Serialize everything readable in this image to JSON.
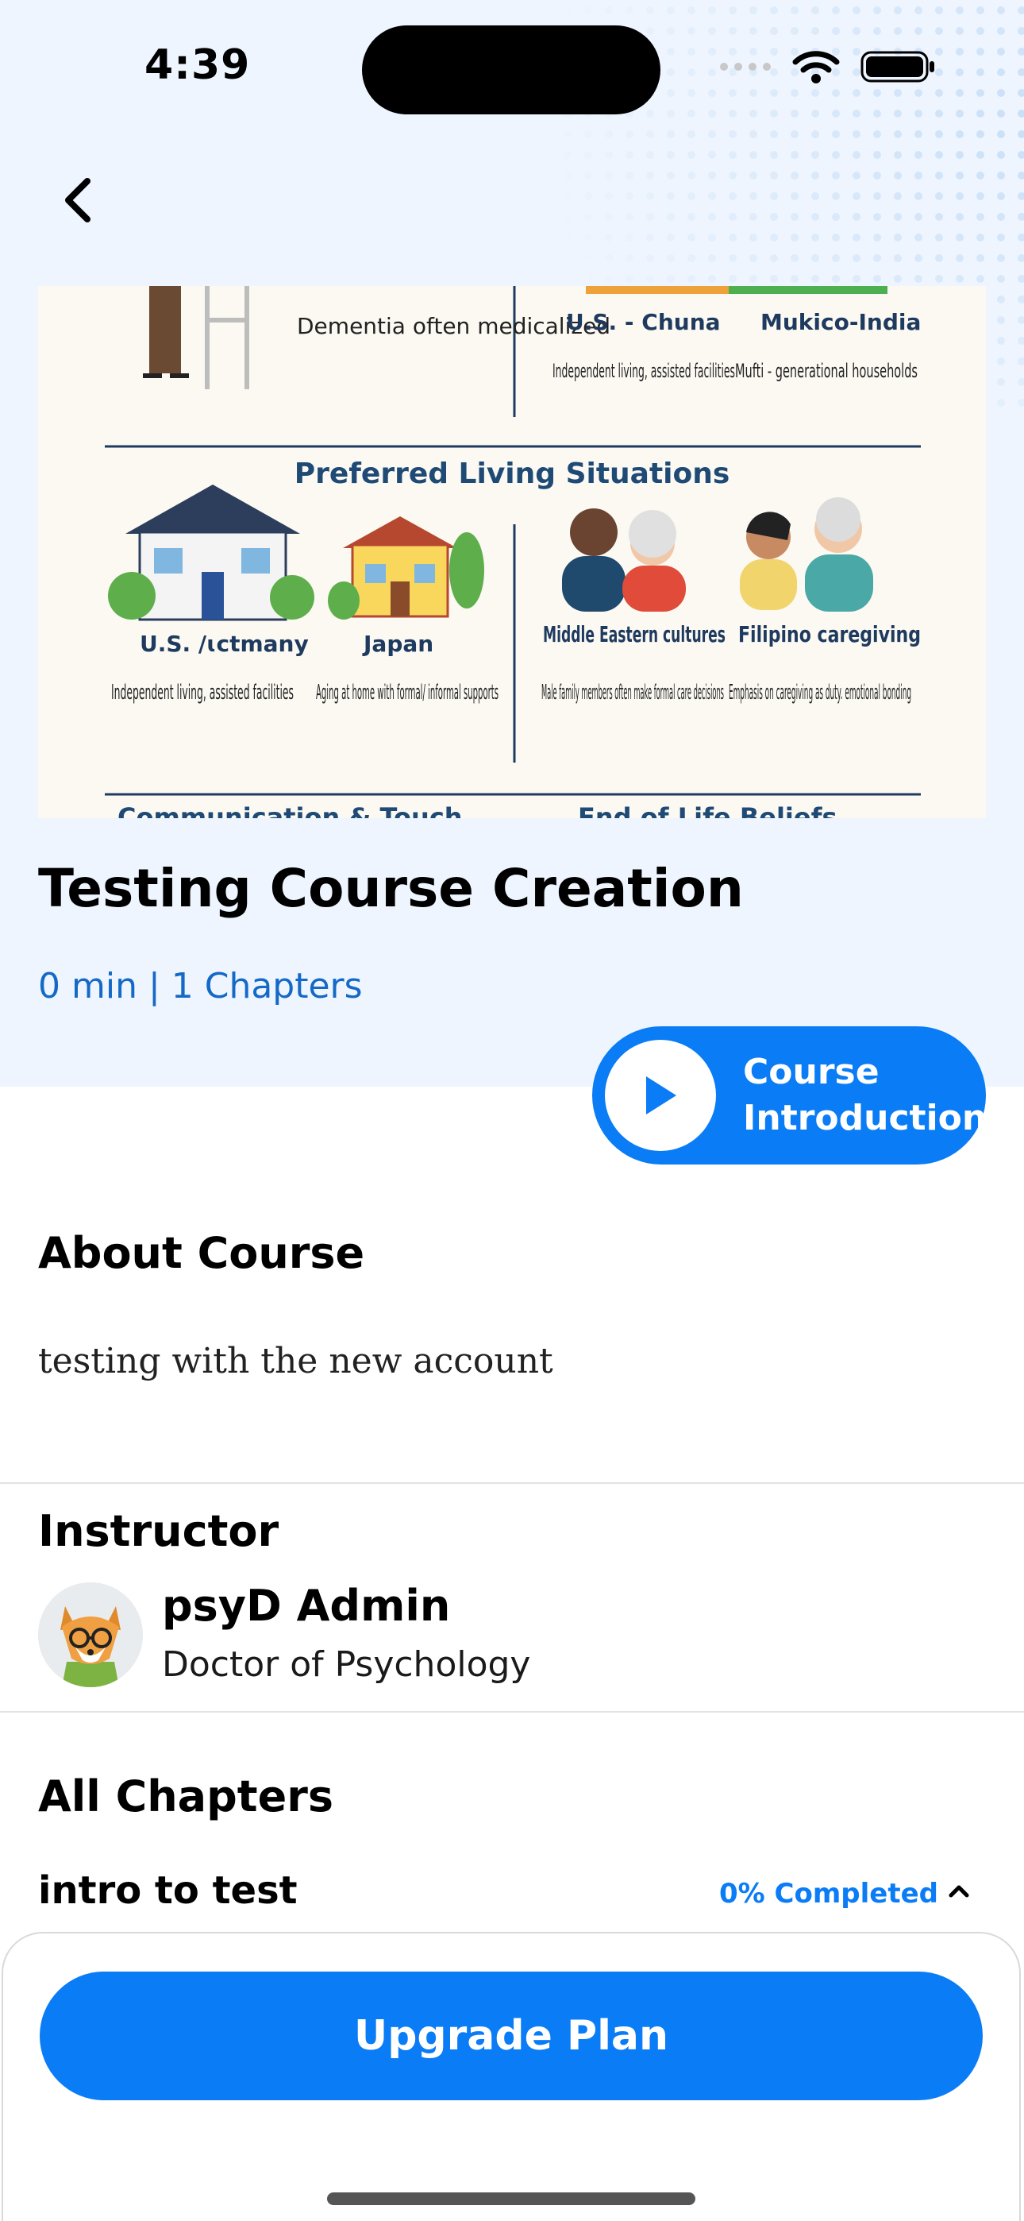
{
  "status_bar": {
    "time": "4:39"
  },
  "course": {
    "title": "Testing Course Creation",
    "meta": "0 min | 1 Chapters",
    "intro_button": "Course Introduction"
  },
  "hero_image": {
    "top_left_note": "Dementia often medicalized",
    "top_col1_title": "U.S. - Chuna",
    "top_col1_text": "Independent living, assisted facilities",
    "top_col2_title": "Mukico-India",
    "top_col2_text": "Mufti - generational households",
    "section_heading": "Preferred Living Situations",
    "cells": [
      {
        "title": "U.S. /ɩctmany",
        "text": "Independent living, assisted facilities"
      },
      {
        "title": "Japan",
        "text": "Aging at home with formal/ informal supports"
      },
      {
        "title": "Middle Eastern cultures",
        "text": "Male family members often make formal care decisions"
      },
      {
        "title": "Filipino caregiving",
        "text": "Emphasis on caregiving as duty. emotional bonding"
      }
    ],
    "bottom_cut_left": "Communication & Touch",
    "bottom_cut_right": "End of Life Beliefs"
  },
  "about": {
    "title": "About Course",
    "text": "testing with the new account"
  },
  "instructor": {
    "title": "Instructor",
    "name": "psyD Admin",
    "role": "Doctor of Psychology"
  },
  "chapters": {
    "title": "All Chapters",
    "items": [
      {
        "title": "intro to test",
        "progress": "0% Completed"
      }
    ]
  },
  "footer": {
    "upgrade_label": "Upgrade Plan"
  },
  "colors": {
    "accent": "#0a7cf5",
    "hero_bg": "#eef5fe",
    "meta_text": "#1469c7"
  }
}
